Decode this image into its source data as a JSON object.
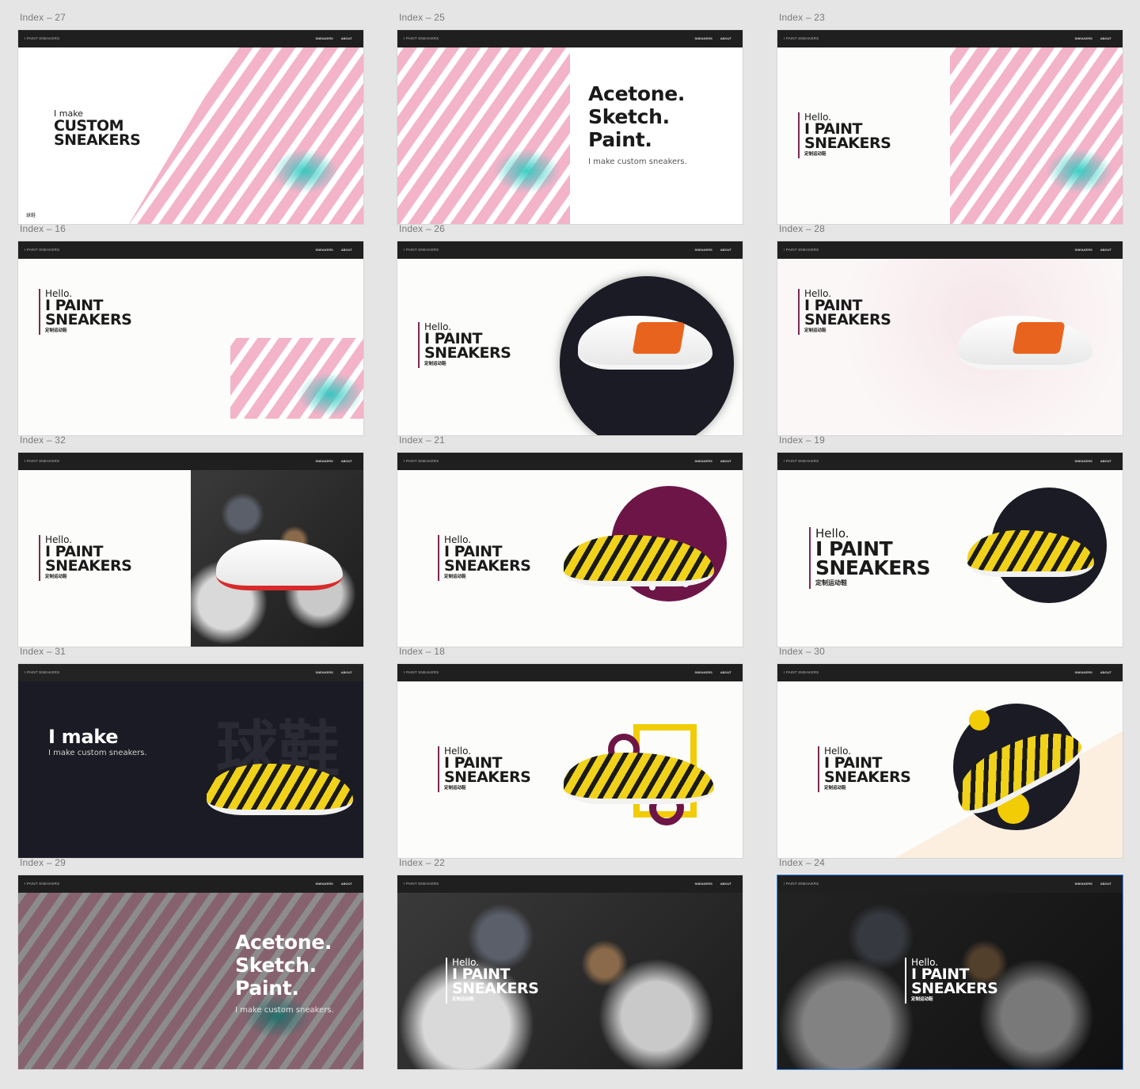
{
  "artboards": {
    "brand": "I PAINT SNEAKERS",
    "nav_sneakers": "SNEAKERS",
    "nav_about": "ABOUT",
    "labels": {
      "i27": "Index – 27",
      "i25": "Index – 25",
      "i23": "Index – 23",
      "i16": "Index – 16",
      "i26": "Index – 26",
      "i28": "Index – 28",
      "i32": "Index – 32",
      "i21": "Index – 21",
      "i19": "Index – 19",
      "i31": "Index – 31",
      "i18": "Index – 18",
      "i30": "Index – 30",
      "i29": "Index – 29",
      "i22": "Index – 22",
      "i24": "Index – 24"
    }
  },
  "copy": {
    "hello": "Hello.",
    "i_paint": "I PAINT",
    "sneakers": "SNEAKERS",
    "chinese_sub": "定制运动鞋",
    "i_make": "I make",
    "custom": "CUSTOM",
    "acetone": "Acetone.",
    "sketch": "Sketch.",
    "paint": "Paint.",
    "tagline": "I make custom sneakers.",
    "corner_cn": "球鞋",
    "watermark_cn": "球鞋"
  },
  "colors": {
    "accent_plum": "#7b2a52",
    "dark_navy": "#1b1b25",
    "yellow": "#f2cc05",
    "topbar": "#1f1f1f"
  }
}
